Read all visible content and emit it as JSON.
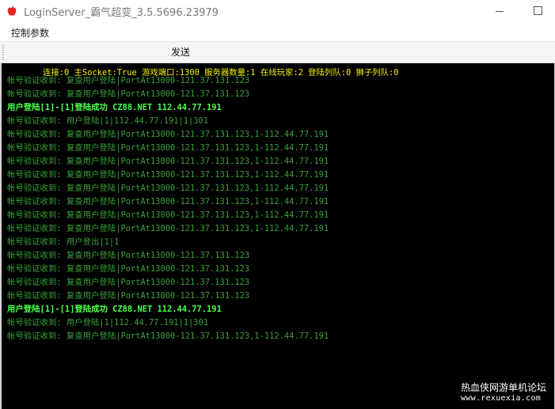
{
  "window": {
    "title": "LoginServer_霸气超变_3.5.5696.23979",
    "icon": "apple-icon",
    "accent_color": "#e8251f"
  },
  "menu": {
    "items": [
      {
        "label": "控制参数"
      }
    ]
  },
  "toolbar": {
    "send_label": "发送"
  },
  "console": {
    "background": "#000000",
    "status_color": "#f2f200",
    "status_text": "连接:0 主Socket:True 游戏端口:1300 服务器数量:1 在线玩家:2 登陆列队:0 狮子列队:0",
    "colors": {
      "dim": "#3aa03a",
      "bright": "#4cff4c"
    },
    "lines": [
      {
        "text": "帐号验证收到: 复查用户登陆|PortAt13000-121.37.131.123",
        "style": "dim"
      },
      {
        "text": "帐号验证收到: 复查用户登陆|PortAt13000-121.37.131.123",
        "style": "dim"
      },
      {
        "text": "用户登陆[1]-[1]登陆成功 CZ88.NET 112.44.77.191",
        "style": "bright"
      },
      {
        "text": "帐号验证收到: 用户登陆|1|112.44.77.191|1|301",
        "style": "dim"
      },
      {
        "text": "帐号验证收到: 复查用户登陆|PortAt13000-121.37.131.123,1-112.44.77.191",
        "style": "dim"
      },
      {
        "text": "帐号验证收到: 复查用户登陆|PortAt13000-121.37.131.123,1-112.44.77.191",
        "style": "dim"
      },
      {
        "text": "帐号验证收到: 复查用户登陆|PortAt13000-121.37.131.123,1-112.44.77.191",
        "style": "dim"
      },
      {
        "text": "帐号验证收到: 复查用户登陆|PortAt13000-121.37.131.123,1-112.44.77.191",
        "style": "dim"
      },
      {
        "text": "帐号验证收到: 复查用户登陆|PortAt13000-121.37.131.123,1-112.44.77.191",
        "style": "dim"
      },
      {
        "text": "帐号验证收到: 复查用户登陆|PortAt13000-121.37.131.123,1-112.44.77.191",
        "style": "dim"
      },
      {
        "text": "帐号验证收到: 复查用户登陆|PortAt13000-121.37.131.123,1-112.44.77.191",
        "style": "dim"
      },
      {
        "text": "帐号验证收到: 复查用户登陆|PortAt13000-121.37.131.123,1-112.44.77.191",
        "style": "dim"
      },
      {
        "text": "帐号验证收到: 用户登出|1|1",
        "style": "dim"
      },
      {
        "text": "帐号验证收到: 复查用户登陆|PortAt13000-121.37.131.123",
        "style": "dim"
      },
      {
        "text": "帐号验证收到: 复查用户登陆|PortAt13000-121.37.131.123",
        "style": "dim"
      },
      {
        "text": "帐号验证收到: 复查用户登陆|PortAt13000-121.37.131.123",
        "style": "dim"
      },
      {
        "text": "帐号验证收到: 复查用户登陆|PortAt13000-121.37.131.123",
        "style": "dim"
      },
      {
        "text": "用户登陆[1]-[1]登陆成功 CZ88.NET 112.44.77.191",
        "style": "bright"
      },
      {
        "text": "帐号验证收到: 用户登陆|1|112.44.77.191|1|301",
        "style": "dim"
      },
      {
        "text": "帐号验证收到: 复查用户登陆|PortAt13000-121.37.131.123,1-112.44.77.191",
        "style": "dim"
      }
    ]
  },
  "watermark": {
    "title": "热血侠网游单机论坛",
    "url": "www.rexuexia.com"
  }
}
